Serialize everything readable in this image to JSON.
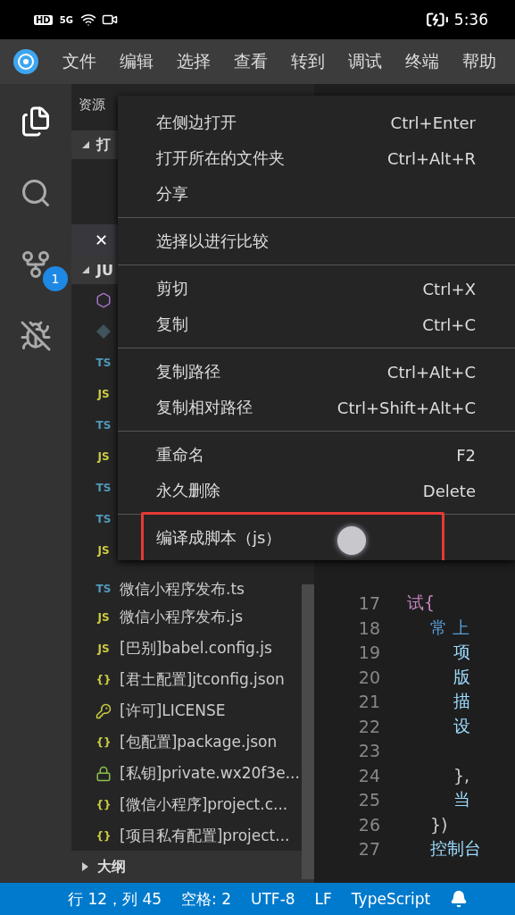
{
  "phone_status": {
    "left": [
      "HD",
      "5G"
    ],
    "time": "5:36"
  },
  "menu_bar": {
    "items": [
      "文件",
      "编辑",
      "选择",
      "查看",
      "转到",
      "调试",
      "终端",
      "帮助"
    ]
  },
  "activity_bar": {
    "items": [
      {
        "kind": "files",
        "selected": true
      },
      {
        "kind": "search",
        "selected": false
      },
      {
        "kind": "git",
        "selected": false,
        "badge": "1"
      },
      {
        "kind": "debug",
        "selected": false
      }
    ]
  },
  "sidebar": {
    "header": "资源",
    "sections": [
      {
        "title": "打",
        "expanded": true
      },
      {
        "title": "JU",
        "expanded": true
      }
    ],
    "open_editor_close": "✕",
    "files": [
      {
        "kind": "shield"
      },
      {
        "kind": "diamond"
      },
      {
        "kind": "ts",
        "tag": "TS"
      },
      {
        "kind": "js",
        "tag": "JS"
      },
      {
        "kind": "ts",
        "tag": "TS"
      },
      {
        "kind": "js",
        "tag": "JS"
      },
      {
        "kind": "ts",
        "tag": "TS"
      },
      {
        "kind": "ts",
        "tag": "TS"
      },
      {
        "kind": "js",
        "tag": "JS"
      },
      {
        "kind": "ts",
        "tag": "TS",
        "name": "微信小程序发布.ts"
      },
      {
        "kind": "js",
        "tag": "JS",
        "name": "微信小程序发布.js"
      },
      {
        "kind": "js",
        "tag": "JS",
        "name": "[巴别]babel.config.js"
      },
      {
        "kind": "json",
        "tag": "{}",
        "name": "[君土配置]jtconfig.json"
      },
      {
        "kind": "key",
        "name": "[许可]LICENSE"
      },
      {
        "kind": "json",
        "tag": "{}",
        "name": "[包配置]package.json"
      },
      {
        "kind": "lock",
        "name": "[私钥]private.wx20f3e..."
      },
      {
        "kind": "json",
        "tag": "{}",
        "name": "[微信小程序]project.c..."
      },
      {
        "kind": "json",
        "tag": "{}",
        "name": "[项目私有配置]project..."
      }
    ],
    "outline": {
      "title": "大纲",
      "expanded": false
    }
  },
  "editor": {
    "lines": [
      {
        "number": "17",
        "code": "试{",
        "kind": "keyword",
        "children": [
          {
            "number": "18",
            "code": "常 上",
            "kind": "decl",
            "children": [
              {
                "number": "19",
                "code": "项",
                "kind": "prop"
              },
              {
                "number": "20",
                "code": "版",
                "kind": "prop"
              },
              {
                "number": "21",
                "code": "描",
                "kind": "prop"
              },
              {
                "number": "22",
                "code": "设",
                "kind": "prop",
                "children": [
                  {
                    "number": "23"
                  }
                ]
              },
              {
                "number": "24",
                "code": "},",
                "kind": "plain"
              },
              {
                "number": "25",
                "code": "当",
                "kind": "prop"
              }
            ]
          },
          {
            "number": "26",
            "code": "})",
            "kind": "plain"
          },
          {
            "number": "27",
            "code": "控制台",
            "kind": "prop"
          }
        ]
      }
    ]
  },
  "context_menu": {
    "groups": [
      [
        {
          "label": "在侧边打开",
          "shortcut": "Ctrl+Enter"
        },
        {
          "label": "打开所在的文件夹",
          "shortcut": "Ctrl+Alt+R"
        },
        {
          "label": "分享"
        }
      ],
      [
        {
          "label": "选择以进行比较"
        }
      ],
      [
        {
          "label": "剪切",
          "shortcut": "Ctrl+X"
        },
        {
          "label": "复制",
          "shortcut": "Ctrl+C"
        }
      ],
      [
        {
          "label": "复制路径",
          "shortcut": "Ctrl+Alt+C"
        },
        {
          "label": "复制相对路径",
          "shortcut": "Ctrl+Shift+Alt+C"
        }
      ],
      [
        {
          "label": "重命名",
          "shortcut": "F2"
        },
        {
          "label": "永久删除",
          "shortcut": "Delete"
        }
      ],
      [
        {
          "label": "编译成脚本（js）",
          "highlighted": true
        }
      ]
    ]
  },
  "status_bar": {
    "items": [
      "行 12，列 45",
      "空格: 2",
      "UTF-8",
      "LF",
      "TypeScript"
    ]
  }
}
